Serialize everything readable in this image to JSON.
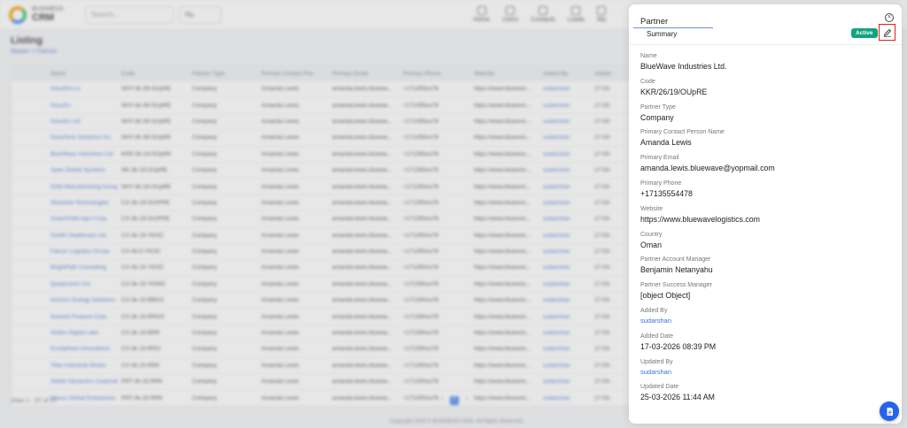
{
  "app": {
    "logo_small": "BUSINESS",
    "logo_name": "CRM",
    "search_placeholder": "Search...",
    "filter_label": "Nu"
  },
  "topnav": [
    {
      "label": "Home",
      "icon": "home-icon"
    },
    {
      "label": "Users",
      "icon": "users-icon"
    },
    {
      "label": "Contacts",
      "icon": "contacts-icon"
    },
    {
      "label": "Leads",
      "icon": "leads-icon"
    },
    {
      "label": "Ma",
      "icon": "more-icon"
    }
  ],
  "listing": {
    "title": "Listing",
    "breadcrumb": "Master  >  Partner",
    "columns": [
      "",
      "Name",
      "Code",
      "Partner Type",
      "Primary Contact Per...",
      "Primary Email",
      "Primary Phone",
      "Website",
      "Added By",
      "Added"
    ],
    "rows": [
      [
        "HouzEnt.co",
        "NHY-3k-39-OUpRE",
        "Company",
        "Amanda Lewis",
        "amanda.lewis.bluewa...",
        "+171355oo78",
        "https://www.blueexis...",
        "sudarshan",
        "17-03-"
      ],
      [
        "HouzEx",
        "NHY-3k-39-OUpRE",
        "Company",
        "Amanda Lewis",
        "amanda.lewis.bluewa...",
        "+171355oo78",
        "https://www.blueexis...",
        "sudarshan",
        "17-03-"
      ],
      [
        "HouzEx Ltd",
        "NHY-3k-39-OUpRE",
        "Company",
        "Amanda Lewis",
        "amanda.lewis.bluewa...",
        "+171355oo78",
        "https://www.blueexis...",
        "sudarshan",
        "17-03-"
      ],
      [
        "NovaTech Solutions Inc.",
        "NHY-3k-39-OUpRE",
        "Company",
        "Amanda Lewis",
        "amanda.lewis.bluewa...",
        "+171355oo78",
        "https://www.blueexis...",
        "sudarshan",
        "17-03-"
      ],
      [
        "BlueWave Industries Ltd.",
        "KKR-3k-19-OUpRE",
        "Company",
        "Amanda Lewis",
        "amanda.lewis.bluewa...",
        "+171355oo78",
        "https://www.blueexis...",
        "sudarshan",
        "17-03-"
      ],
      [
        "Apex Global Systems",
        "NK-3k-19-OUpRE",
        "Company",
        "Amanda Lewis",
        "amanda.lewis.bluewa...",
        "+171355oo78",
        "https://www.blueexis...",
        "sudarshan",
        "17-03-"
      ],
      [
        "Orbit Manufacturing Group",
        "NHY-3k-19-OUpRE",
        "Company",
        "Amanda Lewis",
        "amanda.lewis.bluewa...",
        "+171355oo78",
        "https://www.blueexis...",
        "sudarshan",
        "17-03-"
      ],
      [
        "Silverline Technologies",
        "CX-3k-19-OUrPRE",
        "Company",
        "Amanda Lewis",
        "amanda.lewis.bluewa...",
        "+171355oo78",
        "https://www.blueexis...",
        "sudarshan",
        "17-03-"
      ],
      [
        "GreenField Agro Corp.",
        "CX-3k-19-OUrPRE",
        "Company",
        "Amanda Lewis",
        "amanda.lewis.bluewa...",
        "+171355oo78",
        "https://www.blueexis...",
        "sudarshan",
        "17-03-"
      ],
      [
        "Zenith Healthcare Ltd.",
        "CX-3k-19-YKOC",
        "Company",
        "Amanda Lewis",
        "amanda.lewis.bluewa...",
        "+171355oo78",
        "https://www.blueexis...",
        "sudarshan",
        "17-03-"
      ],
      [
        "Falcon Logistics Group",
        "CX-3k-5-YKOC",
        "Company",
        "Amanda Lewis",
        "amanda.lewis.bluewa...",
        "+171355oo78",
        "https://www.blueexis...",
        "sudarshan",
        "17-03-"
      ],
      [
        "BrightPath Consulting",
        "CX-3k-15-YKOC",
        "Company",
        "Amanda Lewis",
        "amanda.lewis.bluewa...",
        "+171355oo78",
        "https://www.blueexis...",
        "sudarshan",
        "17-03-"
      ],
      [
        "Quadcomm Ind",
        "CX-3k-15-YKWO",
        "Company",
        "Amanda Lewis",
        "amanda.lewis.bluewa...",
        "+171355oo78",
        "https://www.blueexis...",
        "sudarshan",
        "17-03-"
      ],
      [
        "Horizon Energy Solutions",
        "CX-3k-15-BBKO",
        "Company",
        "Amanda Lewis",
        "amanda.lewis.bluewa...",
        "+171355oo78",
        "https://www.blueexis...",
        "sudarshan",
        "17-03-"
      ],
      [
        "Summit Finance Corp.",
        "CX-3k-15-RRKO",
        "Company",
        "Amanda Lewis",
        "amanda.lewis.bluewa...",
        "+171355oo78",
        "https://www.blueexis...",
        "sudarshan",
        "17-03-"
      ],
      [
        "Vertex Digital Labs",
        "CX-3k-15-BRR",
        "Company",
        "Amanda Lewis",
        "amanda.lewis.bluewa...",
        "+171355oo78",
        "https://www.blueexis...",
        "sudarshan",
        "17-03-"
      ],
      [
        "EcoSphere Innovations",
        "CX-3k-15-RRO",
        "Company",
        "Amanda Lewis",
        "amanda.lewis.bluewa...",
        "+171355oo78",
        "https://www.blueexis...",
        "sudarshan",
        "17-03-"
      ],
      [
        "Titan Industrial Works",
        "CX-3k-15-RRK",
        "Company",
        "Amanda Lewis",
        "amanda.lewis.bluewa...",
        "+171355oo78",
        "https://www.blueexis...",
        "sudarshan",
        "17-03-"
      ],
      [
        "Stellar Dynamics Corporation",
        "PRT-3k-32-RRK",
        "Company",
        "Amanda Lewis",
        "amanda.lewis.bluewa...",
        "+171355oo78",
        "https://www.blueexis...",
        "sudarshan",
        "17-03-"
      ],
      [
        "Nexus Global Enterprises",
        "PRT-3k-32-RRK",
        "Company",
        "Amanda Lewis",
        "amanda.lewis.bluewa...",
        "+171355oo78",
        "https://www.blueexis...",
        "sudarshan",
        "17-03-"
      ]
    ],
    "footer_count": "View 1 - 37 of 37",
    "current_page": "1",
    "copyright": "Copyright 2026 © BUSINESS CRM. All Rights Reserved."
  },
  "drawer": {
    "title": "Partner",
    "close_icon": "close-circle-icon",
    "tab_summary": "Summary",
    "status_badge": "Active",
    "edit_icon": "pencil-icon",
    "fab_icon": "document-icon",
    "accent_color": "#2563eb",
    "status_color": "#10a37f",
    "fields": [
      {
        "label": "Name",
        "value": "BlueWave Industries Ltd."
      },
      {
        "label": "Code",
        "value": "KKR/26/19/OUpRE"
      },
      {
        "label": "Partner Type",
        "value": "Company"
      },
      {
        "label": "Primary Contact Person Name",
        "value": "Amanda Lewis"
      },
      {
        "label": "Primary Email",
        "value": "amanda.lewis.bluewave@yopmail.com"
      },
      {
        "label": "Primary Phone",
        "value": "+17135554478"
      },
      {
        "label": "Website",
        "value": "https://www.bluewavelogistics.com"
      },
      {
        "label": "Country",
        "value": "Oman"
      },
      {
        "label": "Partner Account Manager",
        "value": "Benjamin Netanyahu"
      },
      {
        "label": "Partner Success Manager",
        "value": "[object Object]"
      },
      {
        "label": "Added By",
        "value": "sudarshan"
      },
      {
        "label": "Added Date",
        "value": "17-03-2026 08:39 PM"
      },
      {
        "label": "Updated By",
        "value": "sudarshan"
      },
      {
        "label": "Updated Date",
        "value": "25-03-2026 11:44 AM"
      }
    ]
  }
}
